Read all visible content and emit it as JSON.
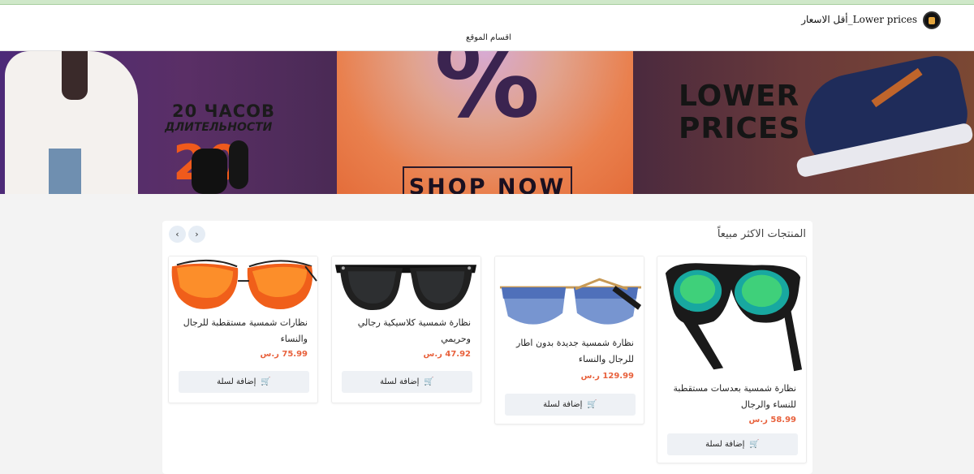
{
  "header": {
    "brand": "أقل الاسعار_Lower prices",
    "nav_categories": "اقسام الموقع"
  },
  "banner": {
    "cyrillic_line1": "20 ЧАСОВ",
    "cyrillic_line2": "ДЛИТЕЛЬНОСТИ",
    "big_number": "20",
    "percent": "%",
    "shop_now": "SHOP NOW",
    "lower_prices": "LOWER PRICES"
  },
  "section": {
    "title": "المنتجات الاكثر مبيعاً",
    "prev_icon": "‹",
    "next_icon": "›"
  },
  "products": [
    {
      "name": "نظارة شمسية بعدسات مستقطبة للنساء والرجال",
      "price": "58.99 ر.س",
      "button": "إضافة لسلة",
      "icon": "cart-icon"
    },
    {
      "name": "نظارة شمسية جديدة بدون اطار للرجال والنساء",
      "price": "129.99 ر.س",
      "button": "إضافة لسلة",
      "icon": "cart-icon"
    },
    {
      "name": "نظارة شمسية كلاسيكية رجالي وحريمي",
      "price": "47.92 ر.س",
      "button": "إضافة لسلة",
      "icon": "cart-icon"
    },
    {
      "name": "نظارات شمسية مستقطبة للرجال والنساء",
      "price": "75.99 ر.س",
      "button": "إضافة لسلة",
      "icon": "cart-icon"
    }
  ],
  "colors": {
    "price": "#e8613c",
    "button_bg": "#eef1f5",
    "accent_top": "#cfe8c9"
  }
}
